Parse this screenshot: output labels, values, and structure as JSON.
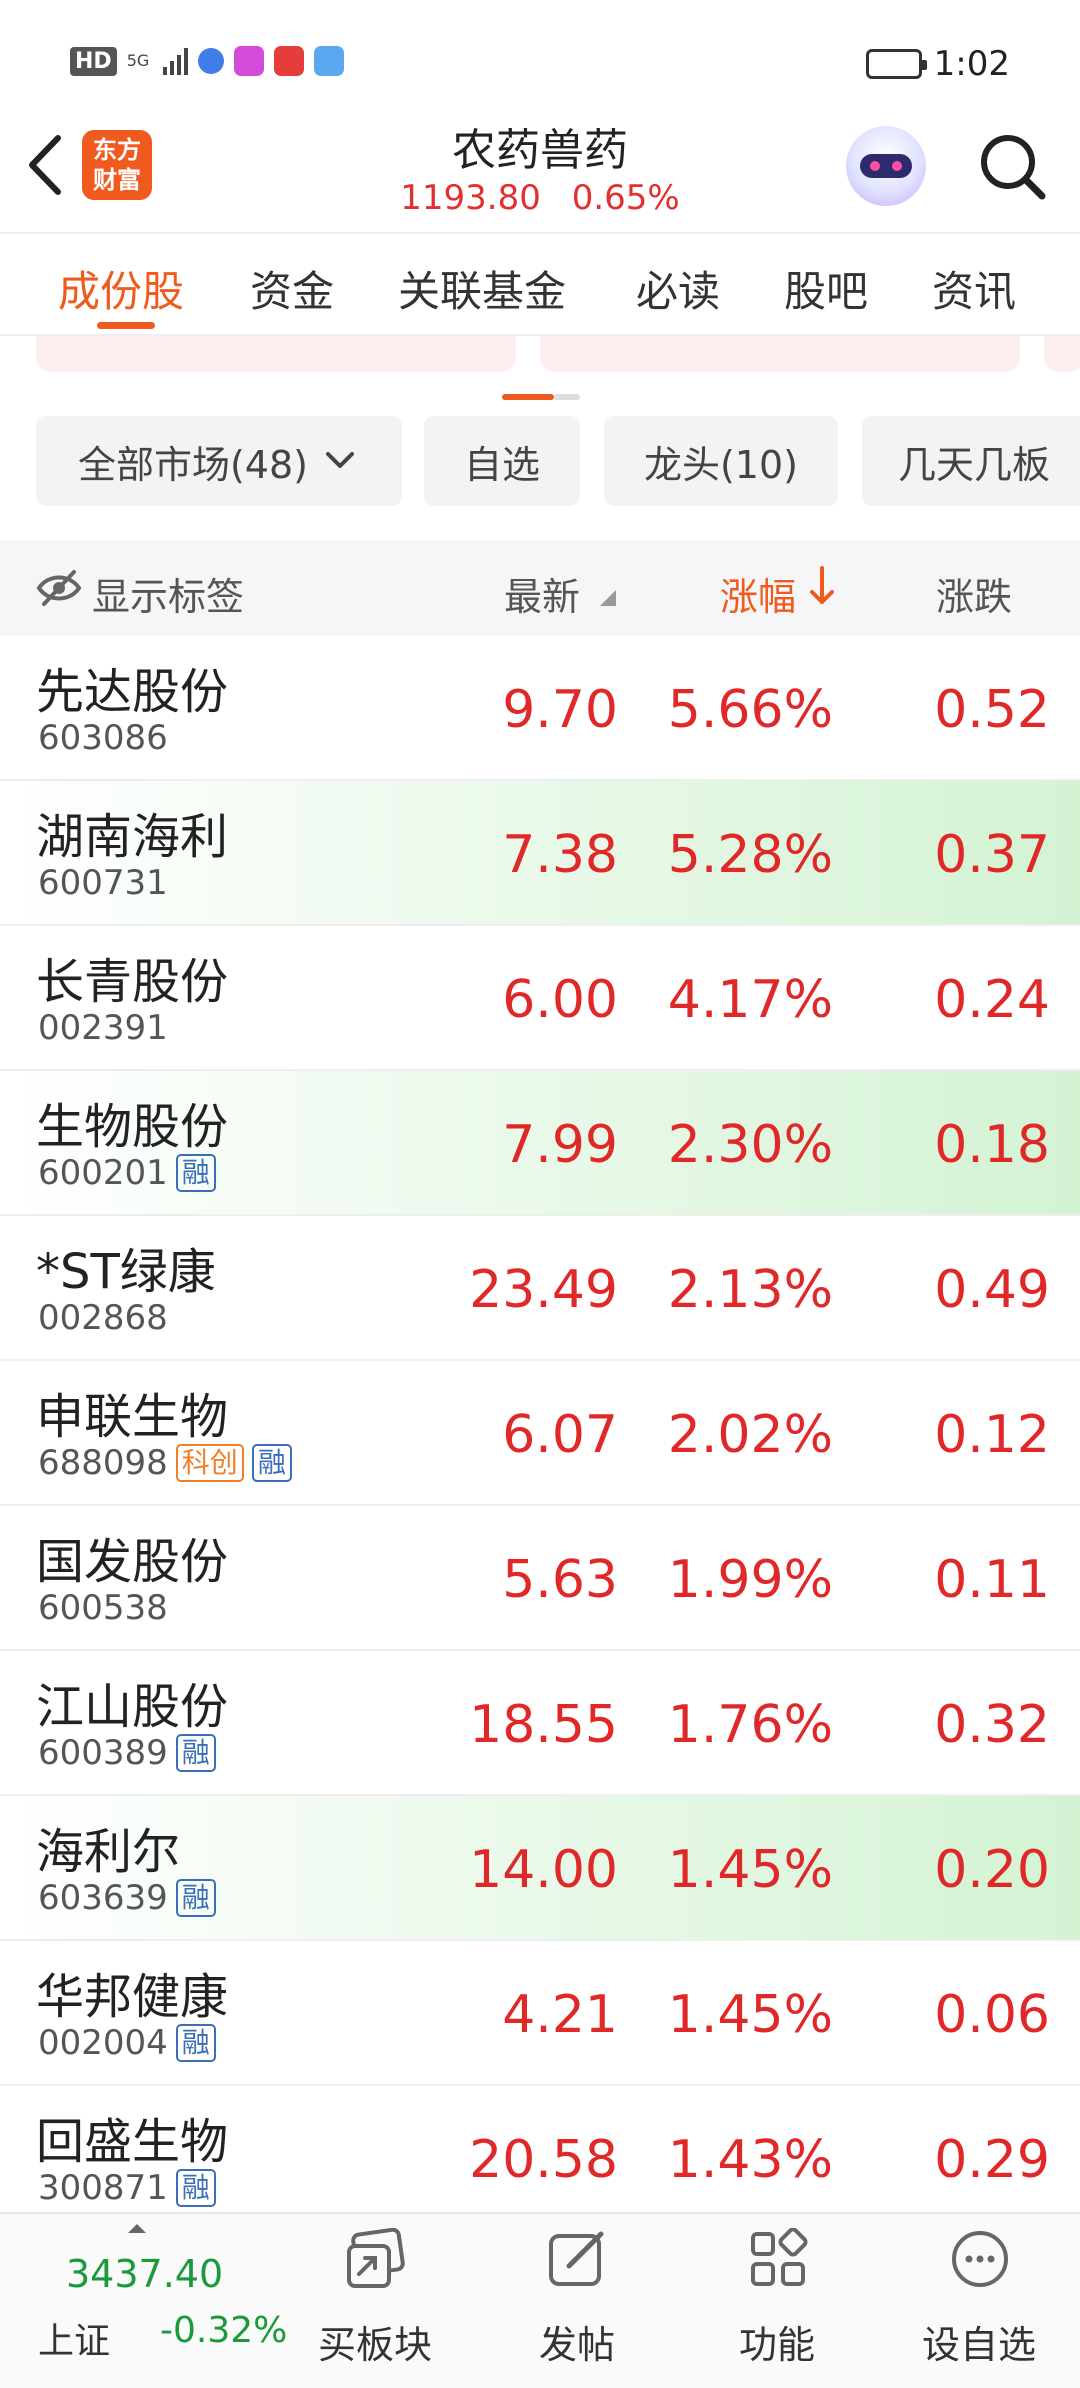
{
  "status_bar": {
    "left_badges": [
      "HD",
      "5G"
    ],
    "time": "1:02",
    "app_colors": [
      "#3f7ee8",
      "#d54bd9",
      "#e53c3c",
      "#5aa9f0"
    ]
  },
  "header": {
    "logo_line1": "东方",
    "logo_line2": "财富",
    "title": "农药兽药",
    "price": "1193.80",
    "change_pct": "0.65%",
    "accent_color": "#f05a1e"
  },
  "tabs": [
    "成份股",
    "资金",
    "关联基金",
    "必读",
    "股吧",
    "资讯"
  ],
  "filters": {
    "market": "全部市场(48)",
    "watch": "自选",
    "leader": "龙头(10)",
    "streak": "几天几板"
  },
  "columns": {
    "show_tags": "显示标签",
    "latest": "最新",
    "change_pct": "涨幅",
    "change": "涨跌"
  },
  "stocks": [
    {
      "name": "先达股份",
      "code": "603086",
      "price": "9.70",
      "pct": "5.66%",
      "change": "0.52",
      "tags": [],
      "highlight": false
    },
    {
      "name": "湖南海利",
      "code": "600731",
      "price": "7.38",
      "pct": "5.28%",
      "change": "0.37",
      "tags": [],
      "highlight": true
    },
    {
      "name": "长青股份",
      "code": "002391",
      "price": "6.00",
      "pct": "4.17%",
      "change": "0.24",
      "tags": [],
      "highlight": false
    },
    {
      "name": "生物股份",
      "code": "600201",
      "price": "7.99",
      "pct": "2.30%",
      "change": "0.18",
      "tags": [
        "融"
      ],
      "highlight": true
    },
    {
      "name": "*ST绿康",
      "code": "002868",
      "price": "23.49",
      "pct": "2.13%",
      "change": "0.49",
      "tags": [],
      "highlight": false
    },
    {
      "name": "申联生物",
      "code": "688098",
      "price": "6.07",
      "pct": "2.02%",
      "change": "0.12",
      "tags": [
        "科创",
        "融"
      ],
      "highlight": false
    },
    {
      "name": "国发股份",
      "code": "600538",
      "price": "5.63",
      "pct": "1.99%",
      "change": "0.11",
      "tags": [],
      "highlight": false
    },
    {
      "name": "江山股份",
      "code": "600389",
      "price": "18.55",
      "pct": "1.76%",
      "change": "0.32",
      "tags": [
        "融"
      ],
      "highlight": false
    },
    {
      "name": "海利尔",
      "code": "603639",
      "price": "14.00",
      "pct": "1.45%",
      "change": "0.20",
      "tags": [
        "融"
      ],
      "highlight": true
    },
    {
      "name": "华邦健康",
      "code": "002004",
      "price": "4.21",
      "pct": "1.45%",
      "change": "0.06",
      "tags": [
        "融"
      ],
      "highlight": false
    },
    {
      "name": "回盛生物",
      "code": "300871",
      "price": "20.58",
      "pct": "1.43%",
      "change": "0.29",
      "tags": [
        "融"
      ],
      "highlight": false
    }
  ],
  "bottom_bar": {
    "index_value": "3437.40",
    "index_name": "上证",
    "index_pct": "-0.32%",
    "actions": [
      {
        "label": "买板块",
        "icon": "buy-sector-icon"
      },
      {
        "label": "发帖",
        "icon": "edit-post-icon"
      },
      {
        "label": "功能",
        "icon": "grid-function-icon"
      },
      {
        "label": "设自选",
        "icon": "more-dots-icon"
      }
    ]
  }
}
